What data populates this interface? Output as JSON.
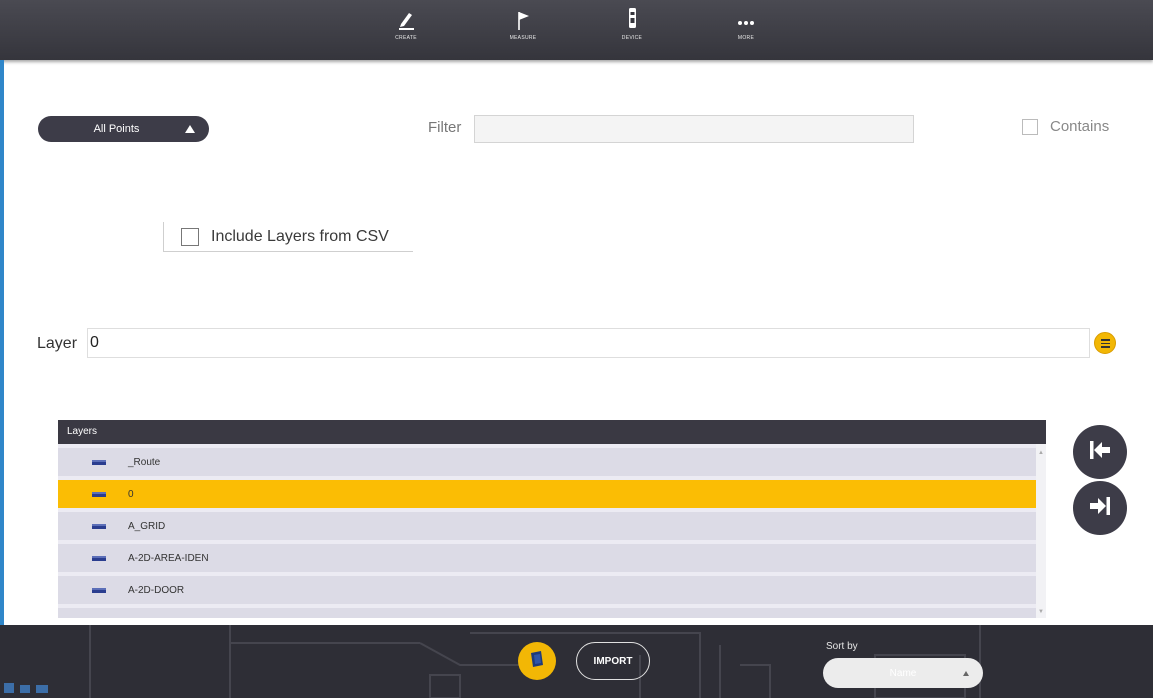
{
  "nav": {
    "items": [
      {
        "label": "CREATE",
        "icon": "pencil-icon"
      },
      {
        "label": "MEASURE",
        "icon": "flag-icon"
      },
      {
        "label": "DEVICE",
        "icon": "device-icon"
      },
      {
        "label": "MORE",
        "icon": "more-dots-icon"
      }
    ]
  },
  "scope": {
    "label": "All Points"
  },
  "filter": {
    "label": "Filter",
    "value": ""
  },
  "contains": {
    "label": "Contains",
    "checked": false
  },
  "csv": {
    "label": "Include Layers from CSV",
    "checked": false
  },
  "layer": {
    "label": "Layer",
    "value": "0"
  },
  "list": {
    "header": "Layers",
    "rows": [
      {
        "name": "_Route",
        "selected": false
      },
      {
        "name": "0",
        "selected": true
      },
      {
        "name": "A_GRID",
        "selected": false
      },
      {
        "name": "A-2D-AREA-IDEN",
        "selected": false
      },
      {
        "name": "A-2D-DOOR",
        "selected": false
      }
    ]
  },
  "bottom": {
    "import_label": "IMPORT",
    "sort_by_label": "Sort by",
    "sort_value": "Name"
  },
  "colors": {
    "accent": "#fbbd04",
    "dark": "#3d3c48",
    "selected_row": "#fbbd04",
    "row": "#dcdbe6"
  }
}
